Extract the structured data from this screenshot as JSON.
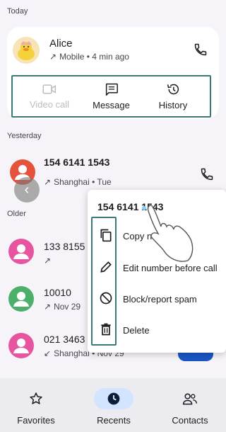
{
  "sections": {
    "today": "Today",
    "yesterday": "Yesterday",
    "older": "Older"
  },
  "today_call": {
    "name": "Alice",
    "detail": "Mobile • 4 min ago",
    "actions": [
      {
        "label": "Video call",
        "icon": "video-camera-icon",
        "enabled": false
      },
      {
        "label": "Message",
        "icon": "message-icon",
        "enabled": true
      },
      {
        "label": "History",
        "icon": "history-icon",
        "enabled": true
      }
    ]
  },
  "yesterday_call": {
    "number": "154 6141 1543",
    "detail": "Shanghai • Tue"
  },
  "older_calls": [
    {
      "number": "133 8155 (",
      "detail": ""
    },
    {
      "number": "10010",
      "detail": "Nov 29"
    },
    {
      "number": "021 3463",
      "detail": "Shanghai • Nov 29"
    }
  ],
  "context_menu": {
    "title": "154 6141 1543",
    "items": [
      {
        "label": "Copy n",
        "icon": "copy-icon"
      },
      {
        "label": "Edit number before call",
        "icon": "pencil-icon"
      },
      {
        "label": "Block/report spam",
        "icon": "block-icon"
      },
      {
        "label": "Delete",
        "icon": "trash-icon"
      }
    ]
  },
  "bottom_nav": {
    "items": [
      {
        "label": "Favorites",
        "icon": "star-icon",
        "active": false
      },
      {
        "label": "Recents",
        "icon": "clock-icon",
        "active": true
      },
      {
        "label": "Contacts",
        "icon": "contacts-icon",
        "active": false
      }
    ]
  },
  "colors": {
    "highlight_border": "#3c7a7a",
    "avatar_pink": "#e754a0",
    "avatar_green": "#4caf6a",
    "avatar_red": "#e5533d",
    "active_pill": "#d3e4ff"
  }
}
